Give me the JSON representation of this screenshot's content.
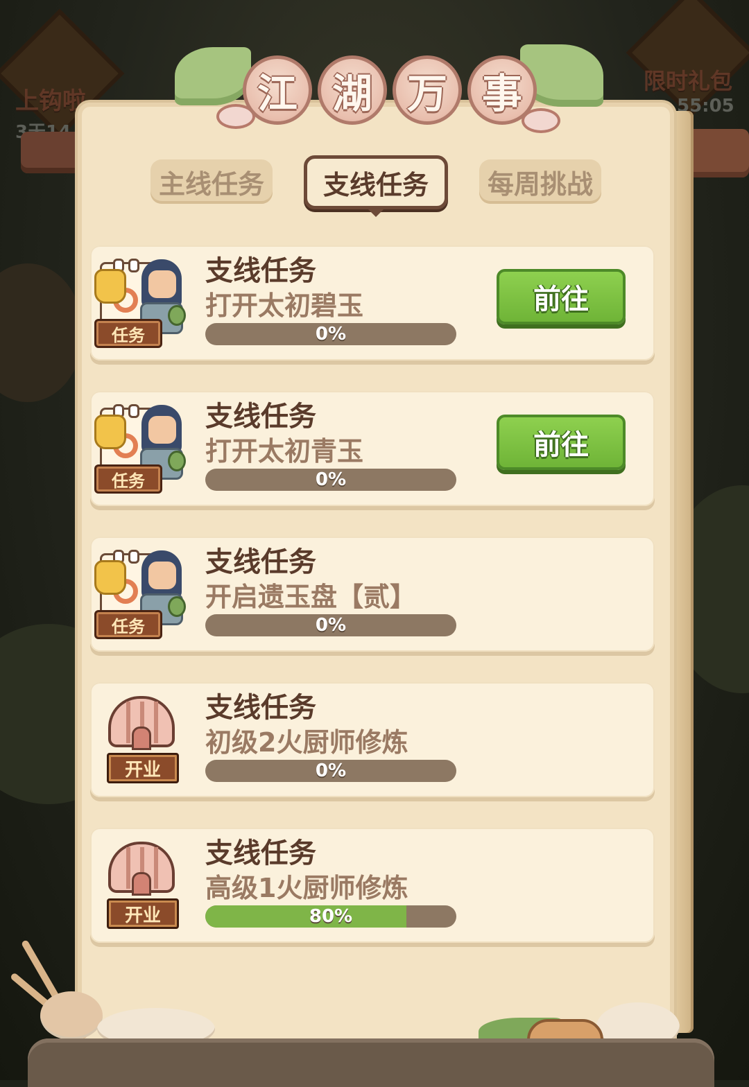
{
  "background": {
    "left_badge": "上钩啦",
    "left_timer": "3天14",
    "right_badge": "限时礼包",
    "right_timer": "55:05"
  },
  "title": [
    "江",
    "湖",
    "万",
    "事"
  ],
  "tabs": [
    {
      "label": "主线任务",
      "active": false
    },
    {
      "label": "支线任务",
      "active": true
    },
    {
      "label": "每周挑战",
      "active": false
    }
  ],
  "tasks": [
    {
      "title": "支线任务",
      "desc": "打开太初碧玉",
      "progress": 0,
      "progress_label": "0%",
      "icon": "quest-scroll-icon",
      "tag": "任务",
      "button": "前往"
    },
    {
      "title": "支线任务",
      "desc": "打开太初青玉",
      "progress": 0,
      "progress_label": "0%",
      "icon": "quest-scroll-icon",
      "tag": "任务",
      "button": "前往"
    },
    {
      "title": "支线任务",
      "desc": "开启遗玉盘【贰】",
      "progress": 0,
      "progress_label": "0%",
      "icon": "quest-scroll-icon",
      "tag": "任务",
      "button": null
    },
    {
      "title": "支线任务",
      "desc": "初级2火厨师修炼",
      "progress": 0,
      "progress_label": "0%",
      "icon": "shop-tent-icon",
      "tag": "开业",
      "button": null
    },
    {
      "title": "支线任务",
      "desc": "高级1火厨师修炼",
      "progress": 0.8,
      "progress_label": "80%",
      "icon": "shop-tent-icon",
      "tag": "开业",
      "button": null
    }
  ],
  "colors": {
    "panel": "#f3e3c4",
    "card": "#fbf1dc",
    "text_dark": "#5a3b2b",
    "text_muted": "#9a7a63",
    "progress_track": "#8d7863",
    "progress_fill": "#7fb548",
    "button_green": "#7fc143"
  }
}
